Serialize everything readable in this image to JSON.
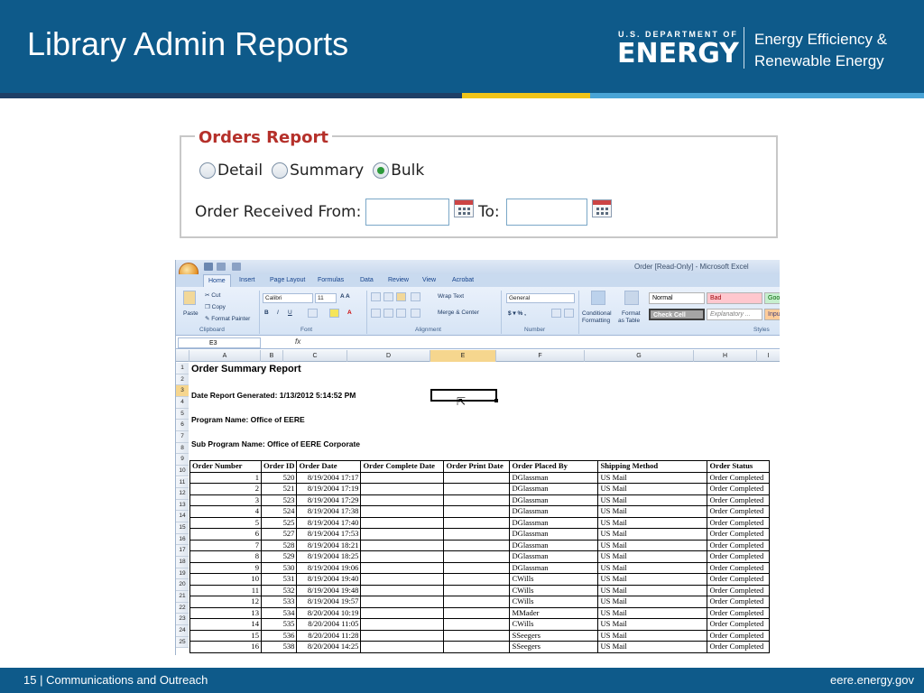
{
  "slide": {
    "title": "Library Admin Reports",
    "logo": {
      "agency_line": "U.S. DEPARTMENT OF",
      "agency_name": "ENERGY",
      "office_line1": "Energy Efficiency &",
      "office_line2": "Renewable Energy"
    },
    "colors": {
      "header_blue": "#0e5a8a",
      "legend_red": "#b5302a",
      "stripe_yellow": "#f0c419",
      "stripe_light": "#49a4d6"
    },
    "footer": {
      "page_number": "15",
      "section": "Communications and Outreach",
      "site": "eere.energy.gov"
    }
  },
  "orders_report": {
    "legend": "Orders Report",
    "report_types": [
      {
        "label": "Detail",
        "selected": false
      },
      {
        "label": "Summary",
        "selected": false
      },
      {
        "label": "Bulk",
        "selected": true
      }
    ],
    "received_from_label": "Order Received From:",
    "to_label": "To:",
    "from_value": "",
    "to_value": "",
    "calendar_icon": "calendar-icon"
  },
  "excel": {
    "window_title": "Order  [Read-Only] - Microsoft Excel",
    "tabs": [
      "Home",
      "Insert",
      "Page Layout",
      "Formulas",
      "Data",
      "Review",
      "View",
      "Acrobat"
    ],
    "active_tab": "Home",
    "ribbon": {
      "clipboard": {
        "paste": "Paste",
        "cut": "Cut",
        "copy": "Copy",
        "format_painter": "Format Painter",
        "label": "Clipboard"
      },
      "font": {
        "name": "Calibri",
        "size": "11",
        "label": "Font"
      },
      "alignment": {
        "wrap_text": "Wrap Text",
        "merge_center": "Merge & Center",
        "label": "Alignment"
      },
      "number": {
        "format": "General",
        "label": "Number"
      },
      "styles": {
        "conditional_formatting_1": "Conditional",
        "conditional_formatting_2": "Formatting",
        "format_table_1": "Format",
        "format_table_2": "as Table",
        "normal": "Normal",
        "bad": "Bad",
        "good": "Goo",
        "check_cell": "Check Cell",
        "explanatory": "Explanatory ...",
        "input": "Inpu",
        "label": "Styles"
      }
    },
    "name_box": "E3",
    "fx": "fx",
    "columns": [
      "A",
      "B",
      "C",
      "D",
      "E",
      "F",
      "G",
      "H",
      "I"
    ],
    "row_numbers": [
      "1",
      "2",
      "3",
      "4",
      "5",
      "6",
      "7",
      "8",
      "9",
      "10",
      "11",
      "12",
      "13",
      "14",
      "15",
      "16",
      "17",
      "18",
      "19",
      "20",
      "21",
      "22",
      "23",
      "24",
      "25"
    ],
    "sheet": {
      "report_title": "Order Summary Report",
      "generated": "Date Report Generated: 1/13/2012 5:14:52 PM",
      "program": "Program Name: Office of EERE",
      "sub_program": "Sub Program Name: Office of EERE Corporate"
    },
    "table_headers": [
      "Order Number",
      "Order ID",
      "Order Date",
      "Order Complete Date",
      "Order Print Date",
      "Order Placed By",
      "Shipping Method",
      "Order Status"
    ],
    "table_rows": [
      [
        "1",
        "520",
        "8/19/2004 17:17",
        "",
        "",
        "DGlassman",
        "US Mail",
        "Order Completed"
      ],
      [
        "2",
        "521",
        "8/19/2004 17:19",
        "",
        "",
        "DGlassman",
        "US Mail",
        "Order Completed"
      ],
      [
        "3",
        "523",
        "8/19/2004 17:29",
        "",
        "",
        "DGlassman",
        "US Mail",
        "Order Completed"
      ],
      [
        "4",
        "524",
        "8/19/2004 17:38",
        "",
        "",
        "DGlassman",
        "US Mail",
        "Order Completed"
      ],
      [
        "5",
        "525",
        "8/19/2004 17:40",
        "",
        "",
        "DGlassman",
        "US Mail",
        "Order Completed"
      ],
      [
        "6",
        "527",
        "8/19/2004 17:53",
        "",
        "",
        "DGlassman",
        "US Mail",
        "Order Completed"
      ],
      [
        "7",
        "528",
        "8/19/2004 18:21",
        "",
        "",
        "DGlassman",
        "US Mail",
        "Order Completed"
      ],
      [
        "8",
        "529",
        "8/19/2004 18:25",
        "",
        "",
        "DGlassman",
        "US Mail",
        "Order Completed"
      ],
      [
        "9",
        "530",
        "8/19/2004 19:06",
        "",
        "",
        "DGlassman",
        "US Mail",
        "Order Completed"
      ],
      [
        "10",
        "531",
        "8/19/2004 19:40",
        "",
        "",
        "CWills",
        "US Mail",
        "Order Completed"
      ],
      [
        "11",
        "532",
        "8/19/2004 19:48",
        "",
        "",
        "CWills",
        "US Mail",
        "Order Completed"
      ],
      [
        "12",
        "533",
        "8/19/2004 19:57",
        "",
        "",
        "CWills",
        "US Mail",
        "Order Completed"
      ],
      [
        "13",
        "534",
        "8/20/2004 10:19",
        "",
        "",
        "MMader",
        "US Mail",
        "Order Completed"
      ],
      [
        "14",
        "535",
        "8/20/2004 11:05",
        "",
        "",
        "CWills",
        "US Mail",
        "Order Completed"
      ],
      [
        "15",
        "536",
        "8/20/2004 11:28",
        "",
        "",
        "SSeegers",
        "US Mail",
        "Order Completed"
      ],
      [
        "16",
        "538",
        "8/20/2004 14:25",
        "",
        "",
        "SSeegers",
        "US Mail",
        "Order Completed"
      ]
    ]
  }
}
